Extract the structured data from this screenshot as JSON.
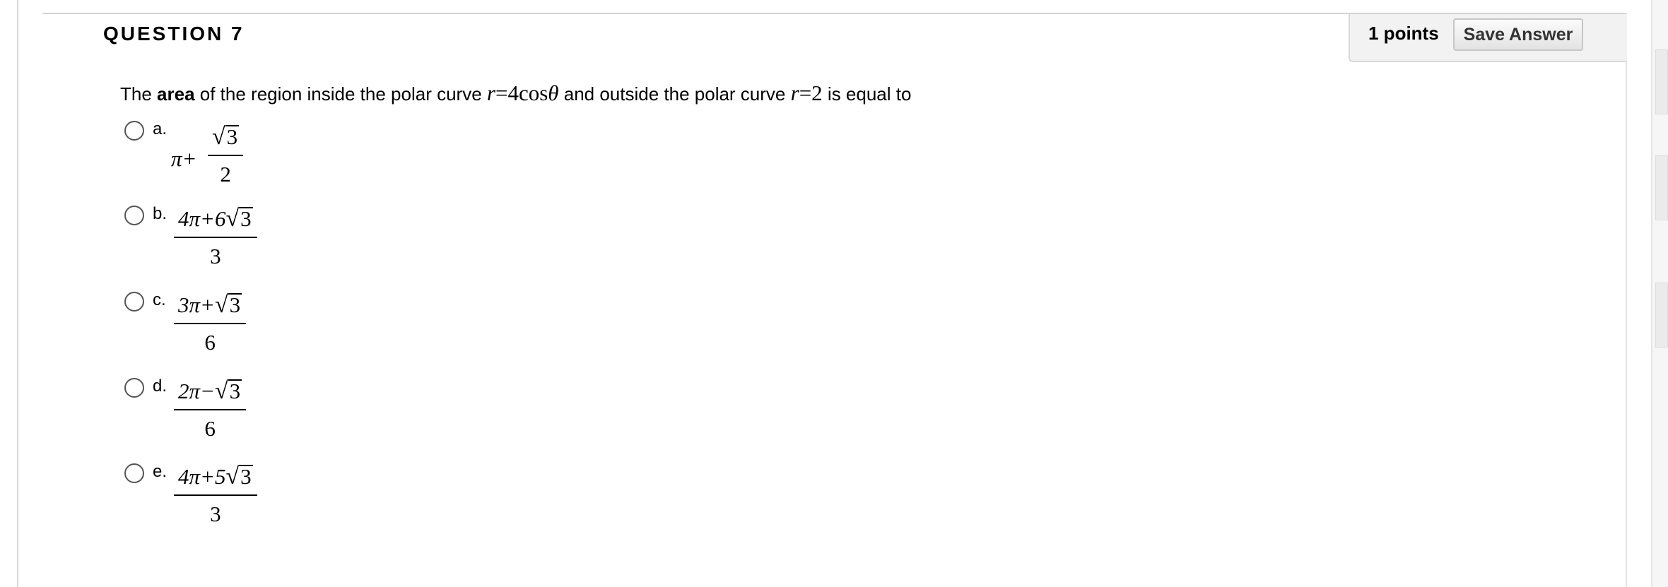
{
  "question": {
    "title": "QUESTION 7",
    "points": "1 points",
    "save_label": "Save Answer",
    "prompt": {
      "before_bold": "The ",
      "bold": "area",
      "part1": " of the region inside the polar curve ",
      "curve1_r": "r",
      "curve1_eq": "=4cos",
      "curve1_theta": "θ",
      "part2": " and outside the polar curve ",
      "curve2_r": "r",
      "curve2_eq": "=2",
      "part3": " is equal to"
    }
  },
  "choices": [
    {
      "label": "a.",
      "lead": "π+",
      "numerator_prefix": "",
      "radicand": "3",
      "denominator": "2"
    },
    {
      "label": "b.",
      "numerator_prefix": "4π+6",
      "radicand": "3",
      "denominator": "3"
    },
    {
      "label": "c.",
      "numerator_prefix": "3π+",
      "radicand": "3",
      "denominator": "6"
    },
    {
      "label": "d.",
      "numerator_prefix": "2π−",
      "radicand": "3",
      "denominator": "6"
    },
    {
      "label": "e.",
      "numerator_prefix": "4π+5",
      "radicand": "3",
      "denominator": "3"
    }
  ],
  "icons": {
    "radio": "radio-unselected-icon",
    "sqrt": "square-root-symbol"
  }
}
